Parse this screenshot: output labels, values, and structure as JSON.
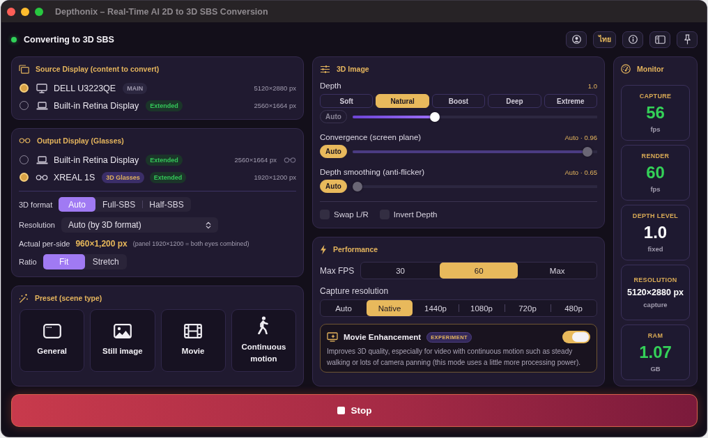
{
  "window": {
    "title": "Depthonix – Real-Time AI 2D to 3D SBS Conversion"
  },
  "header": {
    "status": "Converting to 3D SBS",
    "running": true,
    "language": "ไทย"
  },
  "source_display": {
    "title": "Source Display (content to convert)",
    "displays": [
      {
        "name": "DELL U3223QE",
        "kind": "monitor",
        "badges": [
          {
            "label": "MAIN",
            "kind": "main"
          }
        ],
        "resolution": "5120×2880 px",
        "selected": true
      },
      {
        "name": "Built-in Retina Display",
        "kind": "laptop",
        "badges": [
          {
            "label": "Extended",
            "kind": "extended"
          }
        ],
        "resolution": "2560×1664 px",
        "selected": false
      }
    ]
  },
  "output_display": {
    "title": "Output Display (Glasses)",
    "displays": [
      {
        "name": "Built-in Retina Display",
        "kind": "laptop",
        "badges": [
          {
            "label": "Extended",
            "kind": "extended"
          }
        ],
        "resolution": "2560×1664 px",
        "glasses_indicator": true,
        "selected": false
      },
      {
        "name": "XREAL 1S",
        "kind": "glasses",
        "badges": [
          {
            "label": "3D Glasses",
            "kind": "glasses"
          },
          {
            "label": "Extended",
            "kind": "extended"
          }
        ],
        "resolution": "1920×1200 px",
        "glasses_indicator": false,
        "selected": true
      }
    ],
    "format": {
      "label": "3D format",
      "options": [
        {
          "label": "Auto",
          "selected": true
        },
        {
          "label": "Full-SBS",
          "selected": false
        },
        {
          "label": "Half-SBS",
          "selected": false
        }
      ]
    },
    "resolution": {
      "label": "Resolution",
      "value": "Auto (by 3D format)"
    },
    "per_side": {
      "label": "Actual per-side",
      "value": "960×1,200 px",
      "note": "(panel 1920×1200 = both eyes combined)"
    },
    "ratio": {
      "label": "Ratio",
      "options": [
        {
          "label": "Fit",
          "selected": true
        },
        {
          "label": "Stretch",
          "selected": false
        }
      ]
    }
  },
  "preset": {
    "title": "Preset (scene type)",
    "items": [
      {
        "label": "General",
        "kind": "window",
        "selected": false
      },
      {
        "label": "Still image",
        "kind": "photo",
        "selected": false
      },
      {
        "label": "Movie",
        "kind": "film",
        "selected": false
      },
      {
        "label": "Continuous motion",
        "kind": "walk",
        "selected": false
      }
    ]
  },
  "image_3d": {
    "title": "3D Image",
    "sliders": [
      {
        "label": "Depth",
        "value": "1.0",
        "presets": [
          {
            "label": "Soft",
            "selected": false
          },
          {
            "label": "Natural",
            "selected": true
          },
          {
            "label": "Boost",
            "selected": false
          },
          {
            "label": "Deep",
            "selected": false
          },
          {
            "label": "Extreme",
            "selected": false
          }
        ],
        "auto": {
          "label": "Auto",
          "on": false
        },
        "level": 0.33
      },
      {
        "label": "Convergence (screen plane)",
        "value": "Auto · 0.96",
        "auto": {
          "label": "Auto",
          "on": true
        },
        "level": 0.98
      },
      {
        "label": "Depth smoothing (anti-flicker)",
        "value": "Auto · 0.65",
        "auto": {
          "label": "Auto",
          "on": true
        },
        "level": 0
      }
    ],
    "checkboxes": [
      {
        "label": "Swap L/R",
        "checked": false
      },
      {
        "label": "Invert Depth",
        "checked": false
      }
    ]
  },
  "performance": {
    "title": "Performance",
    "max_fps": {
      "label": "Max FPS",
      "options": [
        {
          "label": "30",
          "selected": false
        },
        {
          "label": "60",
          "selected": true
        },
        {
          "label": "Max",
          "selected": false
        }
      ]
    },
    "capture": {
      "label": "Capture resolution",
      "options": [
        {
          "label": "Auto",
          "selected": false
        },
        {
          "label": "Native",
          "selected": true
        },
        {
          "label": "1440p",
          "selected": false
        },
        {
          "label": "1080p",
          "selected": false
        },
        {
          "label": "720p",
          "selected": false
        },
        {
          "label": "480p",
          "selected": false
        }
      ]
    },
    "enhancement": {
      "title": "Movie Enhancement",
      "badge": "EXPERIMENT",
      "on": true,
      "description": "Improves 3D quality, especially for video with continuous motion such as steady walking or lots of camera panning (this mode uses a little more processing power)."
    }
  },
  "monitor": {
    "title": "Monitor",
    "stats": [
      {
        "label": "CAPTURE",
        "value": "56",
        "unit": "fps",
        "kind": "live"
      },
      {
        "label": "RENDER",
        "value": "60",
        "unit": "fps",
        "kind": "live"
      },
      {
        "label": "DEPTH LEVEL",
        "value": "1.0",
        "unit": "fixed",
        "kind": "fixed"
      },
      {
        "label": "RESOLUTION",
        "value": "5120×2880 px",
        "unit": "capture",
        "kind": "text"
      },
      {
        "label": "RAM",
        "value": "1.07",
        "unit": "GB",
        "kind": "live"
      }
    ]
  },
  "stop": {
    "label": "Stop"
  }
}
